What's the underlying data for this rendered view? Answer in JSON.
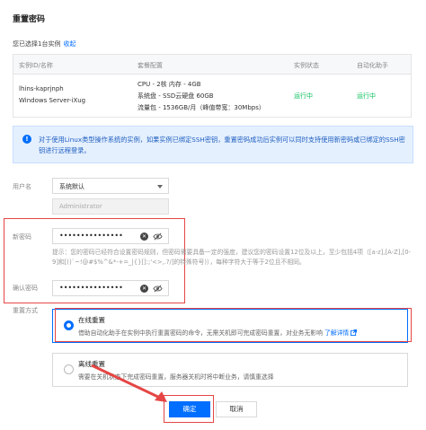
{
  "dialog": {
    "title": "重置密码",
    "selected_text": "您已选择1台实例",
    "collapse_link": "收起"
  },
  "table": {
    "headers": [
      "实例ID/名称",
      "套餐配置",
      "实例状态",
      "自动化助手"
    ],
    "rows": [
      {
        "id": "lhins-kaprjnph",
        "name": "Windows Server-iXug",
        "config": [
          "CPU - 2核 内存 - 4GB",
          "系统盘 - SSD云硬盘 60GB",
          "流量包 - 1536GB/月（峰值带宽：30Mbps）"
        ],
        "status": "运行中",
        "assistant": "运行中"
      }
    ]
  },
  "tip": {
    "icon": "info-icon",
    "text": "对于使用Linux类型操作系统的实例，如果实例已绑定SSH密钥，重置密码成功后实例可以同时支持使用新密码或已绑定的SSH密钥进行远程登录。"
  },
  "form": {
    "username_label": "用户名",
    "username_select": "系统默认",
    "username_input_placeholder": "Administrator",
    "new_password_label": "新密码",
    "new_password_value": "•••••••••••••••",
    "hint": "提示：您的密码已经符合设置密码规则，但密码需要具备一定的强度，建议您的密码设置12位及以上，至少包括4项（[a-z],[A-Z],[0-9]和[()`~!@#$%^&*-+=_|{}[]:;'<>,.?/]的特殊符号)），每种字符大于等于2位且不相同。",
    "confirm_label": "确认密码",
    "confirm_value": "•••••••••••••••",
    "method_label": "重置方式",
    "online": {
      "title": "在线重置",
      "desc": "借助自动化助手在实例中执行重置密码的命令，无需关机即可完成密码重置，对业务无影响",
      "link": "了解详情"
    },
    "offline": {
      "title": "离线重置",
      "desc": "需要在关机状态下完成密码重置，服务器关机时将中断业务，请慎重选择"
    }
  },
  "buttons": {
    "ok": "确定",
    "cancel": "取消"
  },
  "colors": {
    "accent": "#006eff",
    "running": "#0abf5b",
    "annotation": "#e64545"
  }
}
